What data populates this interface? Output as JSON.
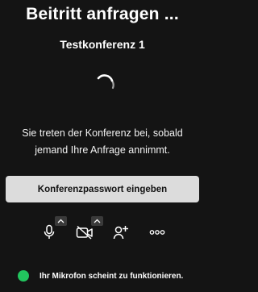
{
  "header": {
    "title": "Beitritt anfragen ...",
    "conference_name": "Testkonferenz 1"
  },
  "lobby": {
    "waiting_message": "Sie treten der Konferenz bei, sobald jemand Ihre Anfrage annimmt.",
    "password_button_label": "Konferenzpasswort eingeben"
  },
  "toolbar": {
    "icons": [
      "microphone-icon",
      "camera-off-icon",
      "add-person-icon",
      "more-icon"
    ]
  },
  "status": {
    "message": "Ihr Mikrofon scheint zu funktionieren.",
    "color": "#22c55e"
  },
  "colors": {
    "background": "#141414",
    "button": "#dcdcdc"
  }
}
